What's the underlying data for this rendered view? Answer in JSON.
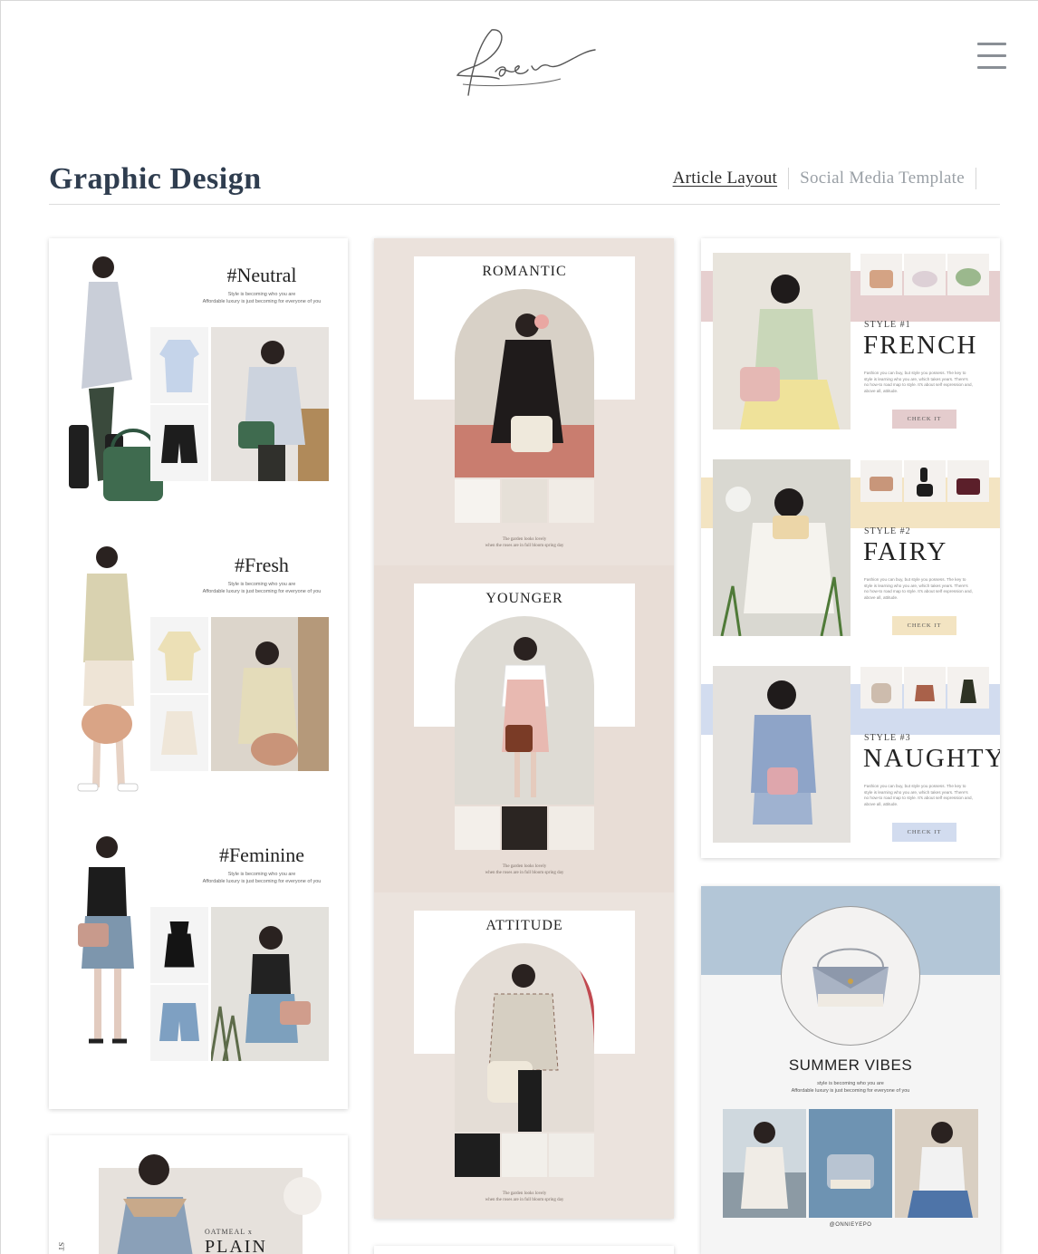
{
  "header": {
    "logo_text": "Rosie",
    "menu_icon": "hamburger-icon"
  },
  "page": {
    "title": "Graphic Design",
    "tabs": [
      {
        "label": "Article Layout",
        "active": true
      },
      {
        "label": "Social Media Template",
        "active": false
      }
    ]
  },
  "colors": {
    "title": "#2f3d4f",
    "card2_bg": "#e9dfd8",
    "french_band": "#e2c7c7",
    "fairy_band": "#f3e3bd",
    "naughty_band": "#cfd9ee",
    "summer_top": "#b3c6d7"
  },
  "cards": {
    "neutral_lookbook": {
      "sections": [
        {
          "title": "#Neutral",
          "line1": "Style is becoming who you are",
          "line2": "Affordable luxury is just becoming for everyone of you"
        },
        {
          "title": "#Fresh",
          "line1": "Style is becoming who you are",
          "line2": "Affordable luxury is just becoming for everyone of you"
        },
        {
          "title": "#Feminine",
          "line1": "Style is becoming who you are",
          "line2": "Affordable luxury is just becoming for everyone of you"
        }
      ]
    },
    "arch_layout": {
      "panels": [
        {
          "title": "ROMANTIC",
          "caption1": "The garden looks lovely",
          "caption2": "when the roses are in full bloom spring day"
        },
        {
          "title": "YOUNGER",
          "caption1": "The garden looks lovely",
          "caption2": "when the roses are in full bloom spring day"
        },
        {
          "title": "ATTITUDE",
          "caption1": "The garden looks lovely",
          "caption2": "when the roses are in full bloom spring day"
        }
      ]
    },
    "style_layout": {
      "rows": [
        {
          "label": "STYLE #1",
          "word": "FRENCH",
          "desc": "Fashion you can buy, but style you possess. The key to style is learning who you are, which takes years. There's no how-to road map to style. It's about self expression and, above all, attitude.",
          "button": "CHECK IT"
        },
        {
          "label": "STYLE #2",
          "word": "FAIRY",
          "desc": "Fashion you can buy, but style you possess. The key to style is learning who you are, which takes years. There's no how-to road map to style. It's about self expression and, above all, attitude.",
          "button": "CHECK IT"
        },
        {
          "label": "STYLE #3",
          "word": "NAUGHTY",
          "desc": "Fashion you can buy, but style you possess. The key to style is learning who you are, which takes years. There's no how-to road map to style. It's about self expression and, above all, attitude.",
          "button": "CHECK IT"
        }
      ]
    },
    "summer_vibes": {
      "title": "SUMMER VIBES",
      "line1": "style is becoming who you are",
      "line2": "Affordable luxury is just becoming for everyone of you",
      "handle": "@ONNIEYEPO"
    },
    "oatmeal_plain": {
      "kicker": "OATMEAL x",
      "word": "PLAIN",
      "side": "ST"
    }
  }
}
